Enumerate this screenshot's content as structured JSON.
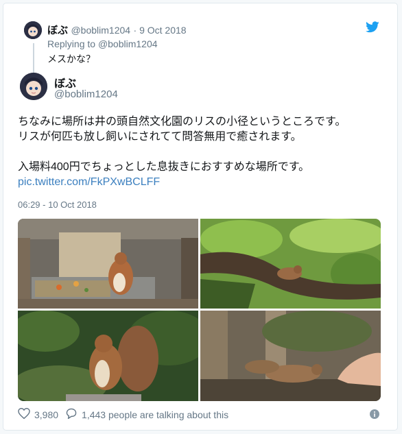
{
  "parent_tweet": {
    "display_name": "ぼぶ",
    "handle": "@boblim1204",
    "date": "· 9 Oct 2018",
    "replying_prefix": "Replying to ",
    "replying_to": "@boblim1204",
    "text": "メスかな？"
  },
  "main_tweet": {
    "display_name": "ぼぶ",
    "handle": "@boblim1204",
    "text_line1": "ちなみに場所は井の頭自然文化園のリスの小径というところです。",
    "text_line2": "リスが何匹も放し飼いにされてて問答無用で癒されます。",
    "text_line3": "入場料400円でちょっとした息抜きにおすすめな場所です。",
    "link": "pic.twitter.com/FkPXwBCLFF",
    "timestamp": "06:29 - 10 Oct 2018"
  },
  "footer": {
    "likes": "3,980",
    "talking": "1,443 people are talking about this"
  },
  "colors": {
    "twitter_blue": "#1da1f2",
    "link": "#3b7fbf",
    "muted": "#657786"
  }
}
